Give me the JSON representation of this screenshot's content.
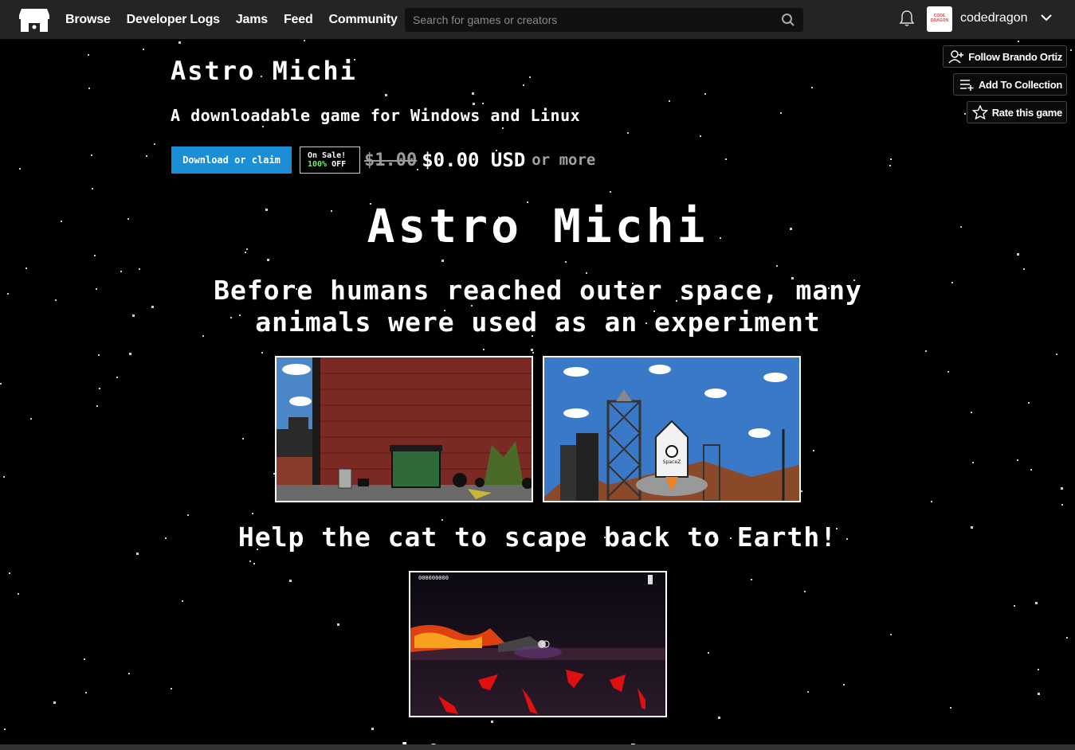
{
  "header": {
    "nav": [
      "Browse",
      "Developer Logs",
      "Jams",
      "Feed",
      "Community"
    ],
    "search_placeholder": "Search for games or creators",
    "username": "codedragon",
    "avatar_text": "CODE DRAGON"
  },
  "actions": {
    "follow": "Follow Brando Ortiz",
    "collection": "Add To Collection",
    "rate": "Rate this game"
  },
  "game": {
    "title": "Astro Michi",
    "subtitle": "A downloadable game for Windows and Linux",
    "download_label": "Download or claim",
    "sale_line1": "On Sale!",
    "sale_pct": "100%",
    "sale_off": "OFF",
    "old_price": "$1.00",
    "new_price": "$0.00 USD",
    "or_more": "or more"
  },
  "description": {
    "big_title": "Astro Michi",
    "intro": "Before humans reached outer space, many animals were used as an experiment",
    "help": "Help the cat to scape back to Earth!",
    "cut_line": "Fight your way home"
  },
  "screenshots": {
    "score": "000000000",
    "rocket_label": "SpaceZ"
  },
  "colors": {
    "header_bg": "#242424",
    "download_btn": "#1a8ed6",
    "sale_green": "#6cf06c"
  }
}
